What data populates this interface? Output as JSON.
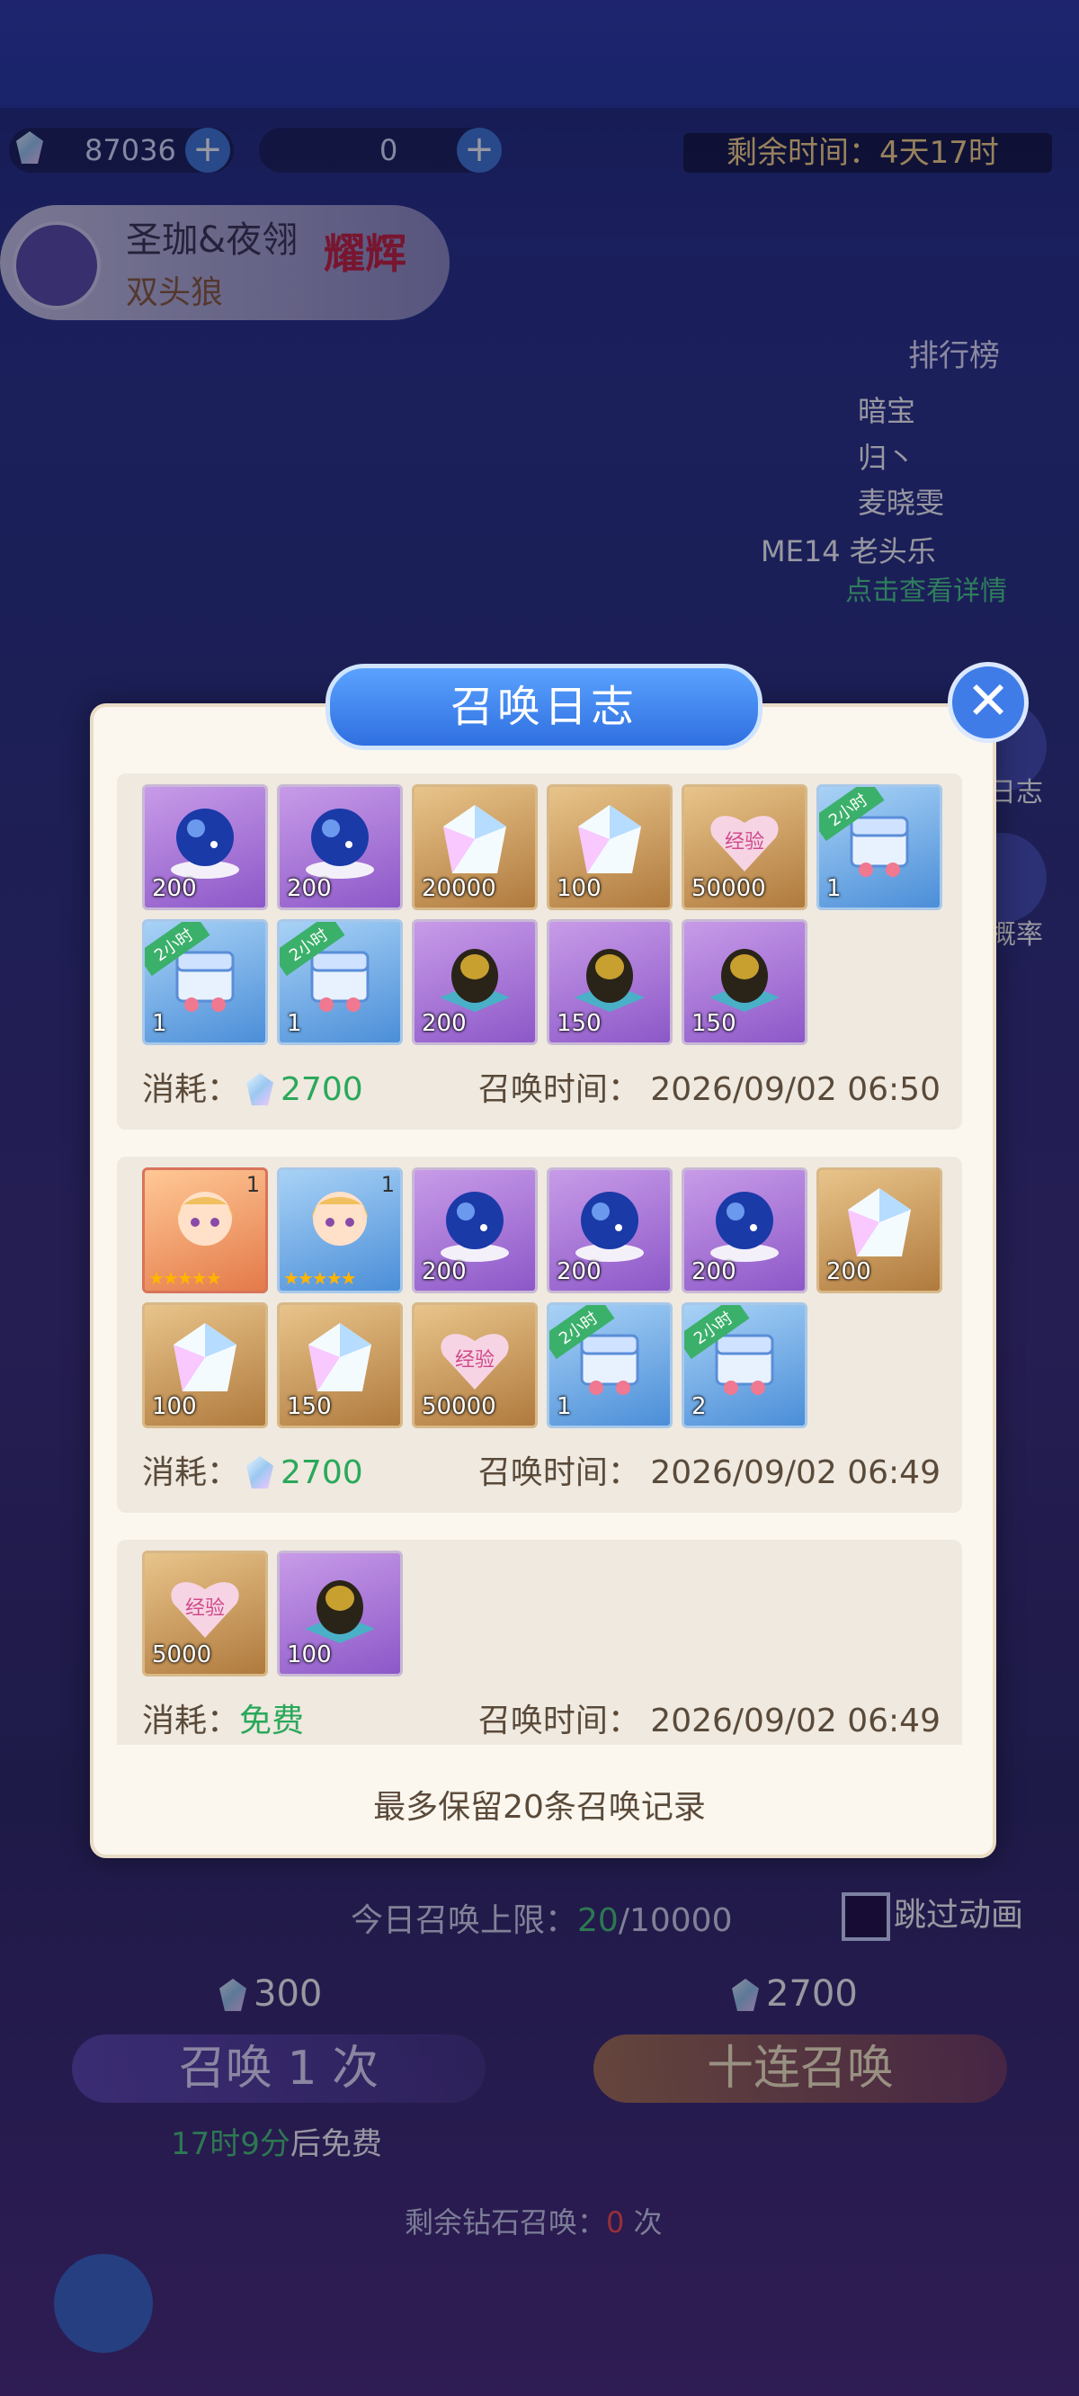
{
  "resources": {
    "diamond_count": "87036",
    "ticket_count": "0"
  },
  "timer": "剩余时间：4天17时",
  "hero": {
    "name": "圣珈&夜翎",
    "subtitle": "双头狼",
    "badge": "耀辉"
  },
  "ranking": {
    "title": "排行榜",
    "items": [
      "暗宝",
      "归丶",
      "麦晓雯"
    ],
    "partial": "ME14   老头乐",
    "link": "点击查看详情"
  },
  "side": {
    "log_label": "日志",
    "prob_label": "概率"
  },
  "bottom": {
    "limit_label": "今日召唤上限：",
    "limit_used": "20",
    "limit_total": "/10000",
    "skip_label": "跳过动画",
    "cost_single": "300",
    "cost_ten": "2700",
    "single_label": "召唤 1 次",
    "ten_label": "十连召唤",
    "free_hours": "17时9分",
    "free_suffix": "后免费",
    "diamond_left_prefix": "剩余钻石召唤：",
    "diamond_left_count": "0",
    "diamond_left_suffix": "次"
  },
  "modal": {
    "title": "召唤日志",
    "footer_note": "最多保留20条召唤记录",
    "cost_label": "消耗：",
    "time_label": "召唤时间：",
    "entries": [
      {
        "cost": "2700",
        "time": "2026/09/02 06:50",
        "items": [
          {
            "type": "orb",
            "color": "purple",
            "qty": "200"
          },
          {
            "type": "orb",
            "color": "purple",
            "qty": "200"
          },
          {
            "type": "crystal",
            "color": "gold",
            "qty": "20000"
          },
          {
            "type": "crystal",
            "color": "gold",
            "qty": "100"
          },
          {
            "type": "exp-heart",
            "color": "gold",
            "qty": "50000"
          },
          {
            "type": "chest",
            "color": "blue",
            "qty": "1",
            "tag": "2小时"
          },
          {
            "type": "chest",
            "color": "blue",
            "qty": "1",
            "tag": "2小时"
          },
          {
            "type": "chest",
            "color": "blue",
            "qty": "1",
            "tag": "2小时"
          },
          {
            "type": "egg",
            "color": "purple",
            "qty": "200"
          },
          {
            "type": "egg",
            "color": "purple",
            "qty": "150"
          },
          {
            "type": "egg",
            "color": "purple",
            "qty": "150"
          }
        ]
      },
      {
        "cost": "2700",
        "time": "2026/09/02 06:49",
        "items": [
          {
            "type": "character",
            "color": "orange",
            "qty": "",
            "level": "1",
            "stars": "★★★★★"
          },
          {
            "type": "character",
            "color": "blue",
            "qty": "",
            "level": "1",
            "stars": "★★★★★"
          },
          {
            "type": "orb",
            "color": "purple",
            "qty": "200"
          },
          {
            "type": "orb",
            "color": "purple",
            "qty": "200"
          },
          {
            "type": "orb",
            "color": "purple",
            "qty": "200"
          },
          {
            "type": "crystal",
            "color": "gold",
            "qty": "200"
          },
          {
            "type": "crystal",
            "color": "gold",
            "qty": "100"
          },
          {
            "type": "crystal",
            "color": "gold",
            "qty": "150"
          },
          {
            "type": "exp-heart",
            "color": "gold",
            "qty": "50000"
          },
          {
            "type": "chest",
            "color": "blue",
            "qty": "1",
            "tag": "2小时"
          },
          {
            "type": "chest",
            "color": "blue",
            "qty": "2",
            "tag": "2小时"
          }
        ]
      },
      {
        "cost": "免费",
        "time": "2026/09/02 06:49",
        "items": [
          {
            "type": "exp-heart",
            "color": "gold",
            "qty": "5000"
          },
          {
            "type": "egg",
            "color": "purple",
            "qty": "100"
          }
        ]
      },
      {
        "cost": "",
        "time": "",
        "items": [
          {
            "type": "character",
            "color": "orange",
            "qty": ""
          },
          {
            "type": "orb",
            "color": "purple",
            "qty": ""
          },
          {
            "type": "orb",
            "color": "purple",
            "qty": ""
          },
          {
            "type": "crystal",
            "color": "gold",
            "qty": ""
          },
          {
            "type": "crystal",
            "color": "gold",
            "qty": ""
          },
          {
            "type": "crystal",
            "color": "gold",
            "qty": ""
          }
        ]
      }
    ]
  }
}
